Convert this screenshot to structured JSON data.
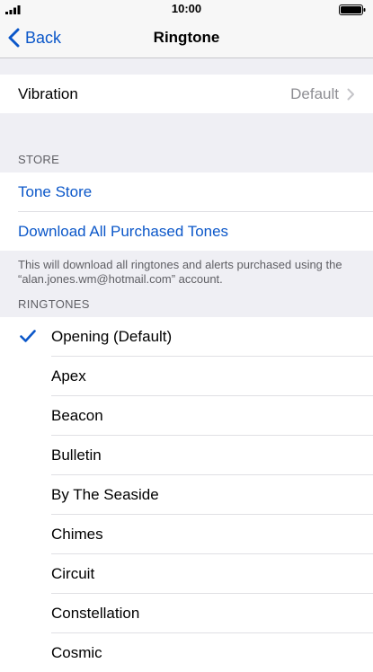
{
  "status": {
    "time": "10:00"
  },
  "nav": {
    "back_label": "Back",
    "title": "Ringtone"
  },
  "vibration": {
    "label": "Vibration",
    "value": "Default"
  },
  "store": {
    "header": "STORE",
    "tone_store": "Tone Store",
    "download_all": "Download All Purchased Tones",
    "note": "This will download all ringtones and alerts purchased using the “alan.jones.wm@hotmail.com” account."
  },
  "ringtones": {
    "header": "RINGTONES",
    "selected": "Opening (Default)",
    "items": [
      "Opening (Default)",
      "Apex",
      "Beacon",
      "Bulletin",
      "By The Seaside",
      "Chimes",
      "Circuit",
      "Constellation",
      "Cosmic"
    ]
  },
  "colors": {
    "accent": "#0b57c9",
    "background": "#efeff4"
  }
}
